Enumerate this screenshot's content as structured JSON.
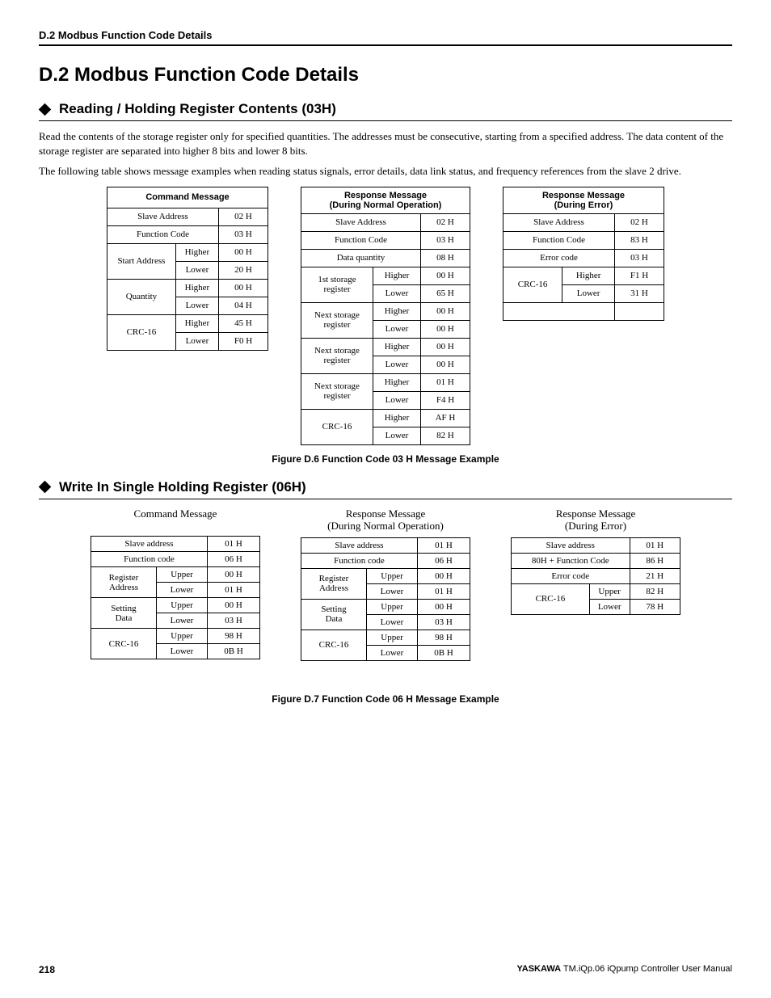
{
  "runningHead": "D.2  Modbus Function Code Details",
  "title": "D.2    Modbus Function Code Details",
  "sec1": {
    "heading": "Reading / Holding Register Contents (03H)",
    "para1": "Read the contents of the storage register only for specified quantities. The addresses must be consecutive, starting from a specified address. The data content of the storage register are separated into higher 8 bits and lower 8 bits.",
    "para2": "The following table shows message examples when reading status signals, error details, data link status, and frequency references from the slave 2 drive.",
    "figcap": "Figure D.6  Function Code 03 H Message Example"
  },
  "t1a": {
    "title": "Command Message",
    "r_slave": {
      "l": "Slave Address",
      "v": "02 H"
    },
    "r_fc": {
      "l": "Function Code",
      "v": "03 H"
    },
    "r_sa": {
      "l": "Start Address",
      "h": "Higher",
      "hv": "00 H",
      "lo": "Lower",
      "lv": "20 H"
    },
    "r_q": {
      "l": "Quantity",
      "h": "Higher",
      "hv": "00 H",
      "lo": "Lower",
      "lv": "04 H"
    },
    "r_crc": {
      "l": "CRC-16",
      "h": "Higher",
      "hv": "45 H",
      "lo": "Lower",
      "lv": "F0 H"
    }
  },
  "t1b": {
    "title1": "Response Message",
    "title2": "(During Normal Operation)",
    "r_slave": {
      "l": "Slave Address",
      "v": "02 H"
    },
    "r_fc": {
      "l": "Function Code",
      "v": "03 H"
    },
    "r_dq": {
      "l": "Data quantity",
      "v": "08 H"
    },
    "r_s1": {
      "l": "1st storage register",
      "h": "Higher",
      "hv": "00 H",
      "lo": "Lower",
      "lv": "65 H"
    },
    "r_s2": {
      "l": "Next storage register",
      "h": "Higher",
      "hv": "00 H",
      "lo": "Lower",
      "lv": "00 H"
    },
    "r_s3": {
      "l": "Next storage register",
      "h": "Higher",
      "hv": "00 H",
      "lo": "Lower",
      "lv": "00 H"
    },
    "r_s4": {
      "l": "Next storage register",
      "h": "Higher",
      "hv": "01 H",
      "lo": "Lower",
      "lv": "F4 H"
    },
    "r_crc": {
      "l": "CRC-16",
      "h": "Higher",
      "hv": "AF H",
      "lo": "Lower",
      "lv": "82 H"
    }
  },
  "t1c": {
    "title1": "Response Message",
    "title2": "(During Error)",
    "r_slave": {
      "l": "Slave Address",
      "v": "02 H"
    },
    "r_fc": {
      "l": "Function Code",
      "v": "83 H"
    },
    "r_ec": {
      "l": "Error code",
      "v": "03 H"
    },
    "r_crc": {
      "l": "CRC-16",
      "h": "Higher",
      "hv": "F1 H",
      "lo": "Lower",
      "lv": "31 H"
    }
  },
  "sec2": {
    "heading": "Write In Single Holding Register (06H)",
    "figcap": "Figure D.7  Function Code 06 H Message Example",
    "h_cmd": "Command Message",
    "h_resp1a": "Response Message",
    "h_resp1b": "(During Normal Operation)",
    "h_err1a": "Response Message",
    "h_err1b": "(During Error)"
  },
  "t2a": {
    "r_slave": {
      "l": "Slave address",
      "v": "01 H"
    },
    "r_fc": {
      "l": "Function code",
      "v": "06 H"
    },
    "r_ra": {
      "l1": "Register",
      "l2": "Address",
      "u": "Upper",
      "uv": "00 H",
      "lo": "Lower",
      "lv": "01 H"
    },
    "r_sd": {
      "l1": "Setting",
      "l2": "Data",
      "u": "Upper",
      "uv": "00 H",
      "lo": "Lower",
      "lv": "03 H"
    },
    "r_crc": {
      "l": "CRC-16",
      "u": "Upper",
      "uv": "98 H",
      "lo": "Lower",
      "lv": "0B H"
    }
  },
  "t2b": {
    "r_slave": {
      "l": "Slave address",
      "v": "01 H"
    },
    "r_fc": {
      "l": "Function code",
      "v": "06 H"
    },
    "r_ra": {
      "l1": "Register",
      "l2": "Address",
      "u": "Upper",
      "uv": "00 H",
      "lo": "Lower",
      "lv": "01 H"
    },
    "r_sd": {
      "l1": "Setting",
      "l2": "Data",
      "u": "Upper",
      "uv": "00 H",
      "lo": "Lower",
      "lv": "03 H"
    },
    "r_crc": {
      "l": "CRC-16",
      "u": "Upper",
      "uv": "98 H",
      "lo": "Lower",
      "lv": "0B H"
    }
  },
  "t2c": {
    "r_slave": {
      "l": "Slave address",
      "v": "01 H"
    },
    "r_fc": {
      "l": "80H + Function Code",
      "v": "86 H"
    },
    "r_ec": {
      "l": "Error code",
      "v": "21 H"
    },
    "r_crc": {
      "l": "CRC-16",
      "u": "Upper",
      "uv": "82 H",
      "lo": "Lower",
      "lv": "78 H"
    }
  },
  "footer": {
    "page": "218",
    "brand": "YASKAWA",
    "manual": " TM.iQp.06 iQpump Controller User Manual"
  }
}
